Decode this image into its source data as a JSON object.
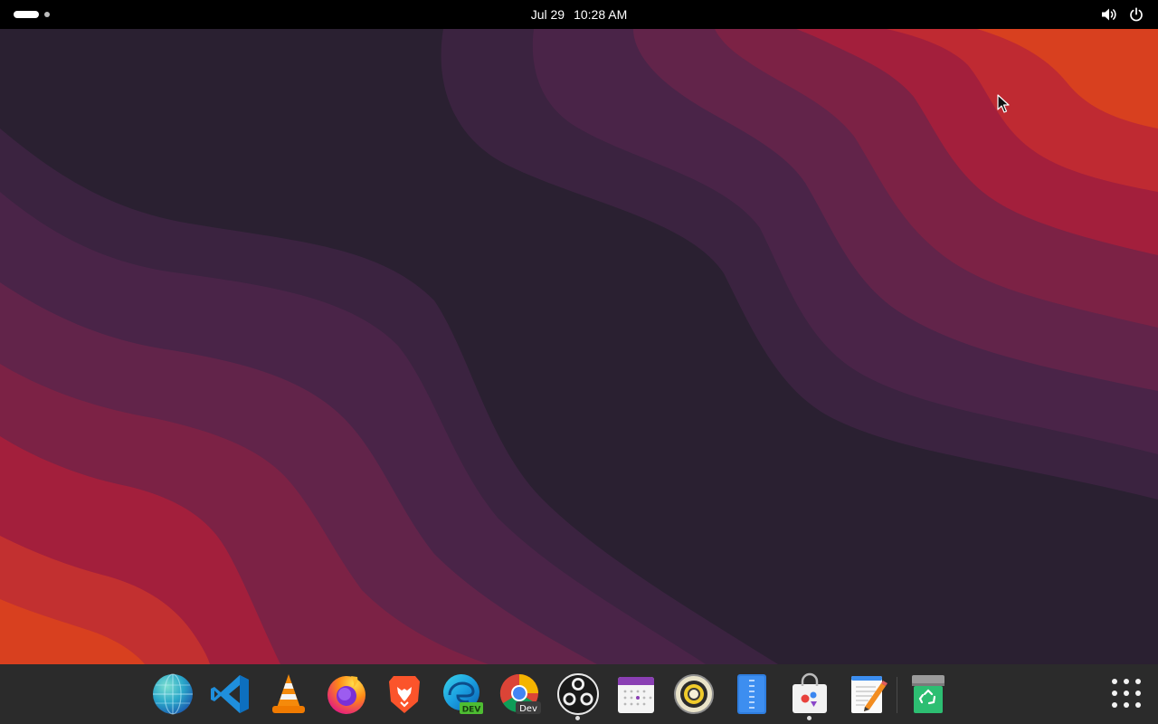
{
  "top_bar": {
    "date": "Jul 29",
    "time": "10:28 AM",
    "workspace_indicator": {
      "active": 1,
      "count": 2
    },
    "icons": [
      "volume-icon",
      "power-icon"
    ]
  },
  "dock": {
    "apps": [
      {
        "name": "globe-browser",
        "icon": "globe-icon",
        "running": false
      },
      {
        "name": "visual-studio-code",
        "icon": "vscode-icon",
        "running": false
      },
      {
        "name": "vlc",
        "icon": "vlc-cone-icon",
        "running": false
      },
      {
        "name": "firefox",
        "icon": "firefox-icon",
        "running": false
      },
      {
        "name": "brave",
        "icon": "brave-lion-icon",
        "running": false
      },
      {
        "name": "edge-dev",
        "icon": "edge-dev-icon",
        "badge": "DEV",
        "running": false
      },
      {
        "name": "chrome-dev",
        "icon": "chrome-dev-icon",
        "badge": "Dev",
        "running": false
      },
      {
        "name": "obs-studio",
        "icon": "obs-icon",
        "running": true
      },
      {
        "name": "calendar",
        "icon": "calendar-icon",
        "running": false
      },
      {
        "name": "rhythmbox",
        "icon": "speaker-icon",
        "running": false
      },
      {
        "name": "file-archiver",
        "icon": "archive-icon",
        "running": false
      },
      {
        "name": "software-store",
        "icon": "store-bag-icon",
        "running": true
      },
      {
        "name": "text-editor",
        "icon": "text-editor-icon",
        "running": false
      },
      {
        "name": "trash",
        "icon": "trash-icon",
        "running": false
      }
    ],
    "show_apps_icon": "grid-dots-icon"
  },
  "colors": {
    "top_bar": "#000000",
    "dock": "#2b2b2b",
    "wallpaper_dark": "#2a2031",
    "wallpaper_purple": "#4a2448",
    "wallpaper_magenta": "#7c2245",
    "wallpaper_red": "#a31f3c",
    "wallpaper_orange": "#d8401f"
  }
}
